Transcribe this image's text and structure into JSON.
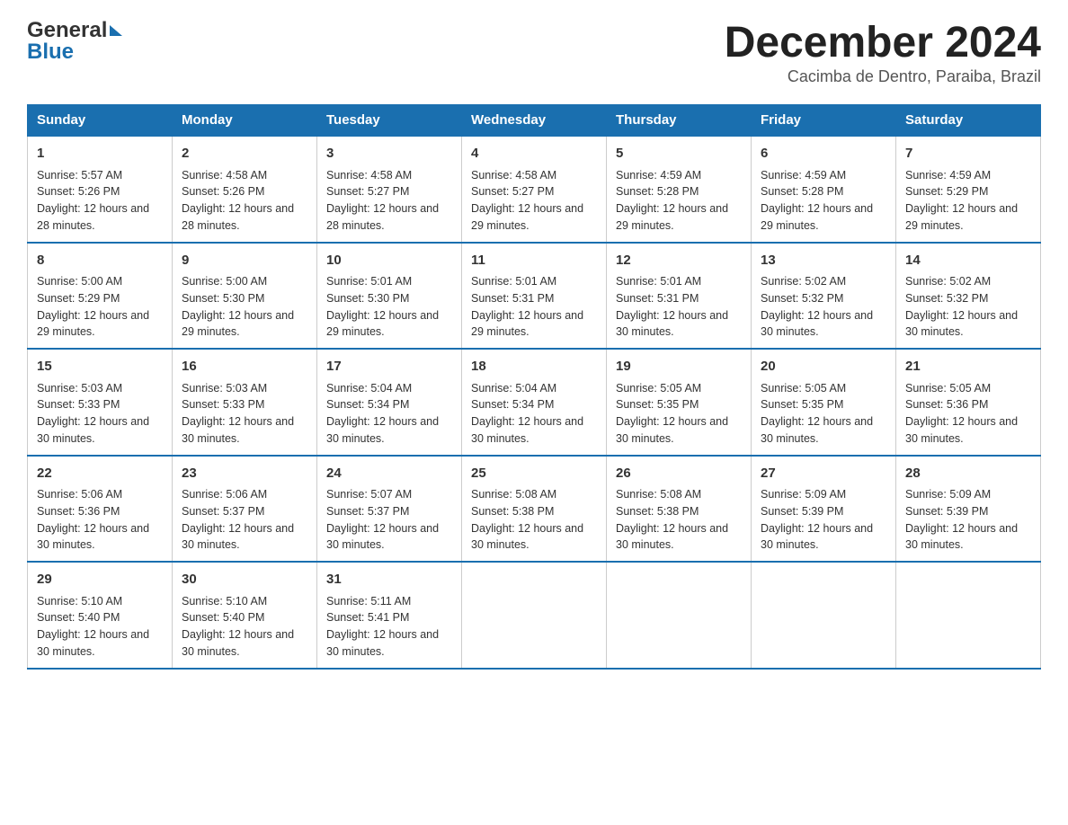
{
  "header": {
    "logo": {
      "line1": "General",
      "line2": "Blue"
    },
    "title": "December 2024",
    "subtitle": "Cacimba de Dentro, Paraiba, Brazil"
  },
  "days_of_week": [
    "Sunday",
    "Monday",
    "Tuesday",
    "Wednesday",
    "Thursday",
    "Friday",
    "Saturday"
  ],
  "weeks": [
    [
      {
        "day": "1",
        "sunrise": "5:57 AM",
        "sunset": "5:26 PM",
        "daylight": "12 hours and 28 minutes."
      },
      {
        "day": "2",
        "sunrise": "4:58 AM",
        "sunset": "5:26 PM",
        "daylight": "12 hours and 28 minutes."
      },
      {
        "day": "3",
        "sunrise": "4:58 AM",
        "sunset": "5:27 PM",
        "daylight": "12 hours and 28 minutes."
      },
      {
        "day": "4",
        "sunrise": "4:58 AM",
        "sunset": "5:27 PM",
        "daylight": "12 hours and 29 minutes."
      },
      {
        "day": "5",
        "sunrise": "4:59 AM",
        "sunset": "5:28 PM",
        "daylight": "12 hours and 29 minutes."
      },
      {
        "day": "6",
        "sunrise": "4:59 AM",
        "sunset": "5:28 PM",
        "daylight": "12 hours and 29 minutes."
      },
      {
        "day": "7",
        "sunrise": "4:59 AM",
        "sunset": "5:29 PM",
        "daylight": "12 hours and 29 minutes."
      }
    ],
    [
      {
        "day": "8",
        "sunrise": "5:00 AM",
        "sunset": "5:29 PM",
        "daylight": "12 hours and 29 minutes."
      },
      {
        "day": "9",
        "sunrise": "5:00 AM",
        "sunset": "5:30 PM",
        "daylight": "12 hours and 29 minutes."
      },
      {
        "day": "10",
        "sunrise": "5:01 AM",
        "sunset": "5:30 PM",
        "daylight": "12 hours and 29 minutes."
      },
      {
        "day": "11",
        "sunrise": "5:01 AM",
        "sunset": "5:31 PM",
        "daylight": "12 hours and 29 minutes."
      },
      {
        "day": "12",
        "sunrise": "5:01 AM",
        "sunset": "5:31 PM",
        "daylight": "12 hours and 30 minutes."
      },
      {
        "day": "13",
        "sunrise": "5:02 AM",
        "sunset": "5:32 PM",
        "daylight": "12 hours and 30 minutes."
      },
      {
        "day": "14",
        "sunrise": "5:02 AM",
        "sunset": "5:32 PM",
        "daylight": "12 hours and 30 minutes."
      }
    ],
    [
      {
        "day": "15",
        "sunrise": "5:03 AM",
        "sunset": "5:33 PM",
        "daylight": "12 hours and 30 minutes."
      },
      {
        "day": "16",
        "sunrise": "5:03 AM",
        "sunset": "5:33 PM",
        "daylight": "12 hours and 30 minutes."
      },
      {
        "day": "17",
        "sunrise": "5:04 AM",
        "sunset": "5:34 PM",
        "daylight": "12 hours and 30 minutes."
      },
      {
        "day": "18",
        "sunrise": "5:04 AM",
        "sunset": "5:34 PM",
        "daylight": "12 hours and 30 minutes."
      },
      {
        "day": "19",
        "sunrise": "5:05 AM",
        "sunset": "5:35 PM",
        "daylight": "12 hours and 30 minutes."
      },
      {
        "day": "20",
        "sunrise": "5:05 AM",
        "sunset": "5:35 PM",
        "daylight": "12 hours and 30 minutes."
      },
      {
        "day": "21",
        "sunrise": "5:05 AM",
        "sunset": "5:36 PM",
        "daylight": "12 hours and 30 minutes."
      }
    ],
    [
      {
        "day": "22",
        "sunrise": "5:06 AM",
        "sunset": "5:36 PM",
        "daylight": "12 hours and 30 minutes."
      },
      {
        "day": "23",
        "sunrise": "5:06 AM",
        "sunset": "5:37 PM",
        "daylight": "12 hours and 30 minutes."
      },
      {
        "day": "24",
        "sunrise": "5:07 AM",
        "sunset": "5:37 PM",
        "daylight": "12 hours and 30 minutes."
      },
      {
        "day": "25",
        "sunrise": "5:08 AM",
        "sunset": "5:38 PM",
        "daylight": "12 hours and 30 minutes."
      },
      {
        "day": "26",
        "sunrise": "5:08 AM",
        "sunset": "5:38 PM",
        "daylight": "12 hours and 30 minutes."
      },
      {
        "day": "27",
        "sunrise": "5:09 AM",
        "sunset": "5:39 PM",
        "daylight": "12 hours and 30 minutes."
      },
      {
        "day": "28",
        "sunrise": "5:09 AM",
        "sunset": "5:39 PM",
        "daylight": "12 hours and 30 minutes."
      }
    ],
    [
      {
        "day": "29",
        "sunrise": "5:10 AM",
        "sunset": "5:40 PM",
        "daylight": "12 hours and 30 minutes."
      },
      {
        "day": "30",
        "sunrise": "5:10 AM",
        "sunset": "5:40 PM",
        "daylight": "12 hours and 30 minutes."
      },
      {
        "day": "31",
        "sunrise": "5:11 AM",
        "sunset": "5:41 PM",
        "daylight": "12 hours and 30 minutes."
      },
      null,
      null,
      null,
      null
    ]
  ],
  "labels": {
    "sunrise": "Sunrise:",
    "sunset": "Sunset:",
    "daylight": "Daylight:"
  },
  "colors": {
    "header_bg": "#1a6faf",
    "header_text": "#ffffff",
    "border": "#cccccc",
    "week_border": "#1a6faf"
  }
}
